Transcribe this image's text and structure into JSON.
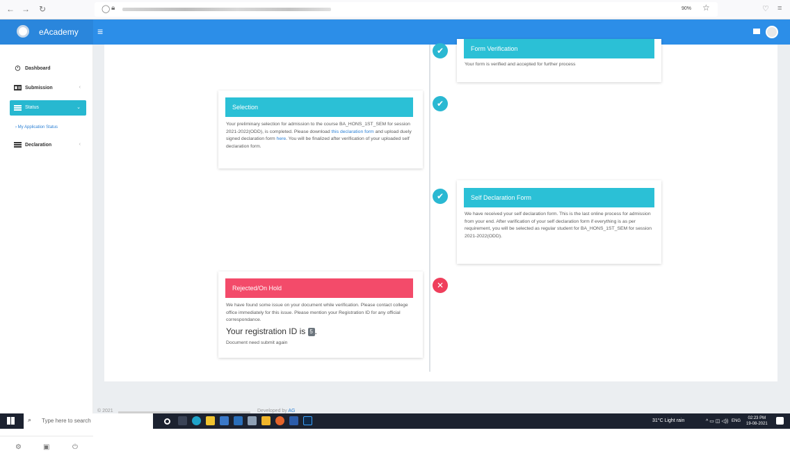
{
  "browser": {
    "zoom": "90%"
  },
  "header": {
    "app_name": "eAcademy"
  },
  "sidebar": {
    "items": [
      {
        "label": "Dashboard"
      },
      {
        "label": "Submission"
      },
      {
        "label": "Status"
      },
      {
        "label": "Declaration"
      }
    ],
    "sub_item": "› My Application Status"
  },
  "timeline": [
    {
      "title": "Form Verification",
      "status": "ok",
      "text": "Your form is verified and accepted for further process"
    },
    {
      "title": "Selection",
      "status": "ok",
      "text_1": "Your preliminary selection for admission to the course BA_HONS_1ST_SEM for session 2021-2022(ODD), is completed. Please download ",
      "link_1": "this declaration form",
      "text_2": " and upload dueIy signed declaration form ",
      "link_2": "here",
      "text_3": ". You will be finalized after verification of your uploaded self declaration form."
    },
    {
      "title": "Self Declaration Form",
      "status": "ok",
      "text": "We have received your self declaration form. This is the last online process for admission from your end. After varification of your self declaration form if everything is as per requirement, you will be selected as regular student for BA_HONS_1ST_SEM for session 2021-2022(ODD)."
    },
    {
      "title": "Rejected/On Hold",
      "status": "rejected",
      "text": "We have found some issue on your document while verification. Please contact college office immediately for this issue. Please mention your Registration ID for any official correspondance.",
      "reg_label": "Your registration ID is",
      "reg_id": "5",
      "reg_suffix": ".",
      "note": "Document need submit again"
    }
  ],
  "footer": {
    "copyright_prefix": "© 2021",
    "developed_by": "Developed by",
    "developer": "AG"
  },
  "taskbar": {
    "search_placeholder": "Type here to search",
    "weather": "31°C  Light rain",
    "lang": "ENG",
    "time": "02:23 PM",
    "date": "19-08-2021"
  },
  "colors": {
    "header_blue": "#2c8ee8",
    "status_teal": "#27b8d0",
    "card_teal": "#2bc0d6",
    "rejected_red": "#f34b6a"
  }
}
